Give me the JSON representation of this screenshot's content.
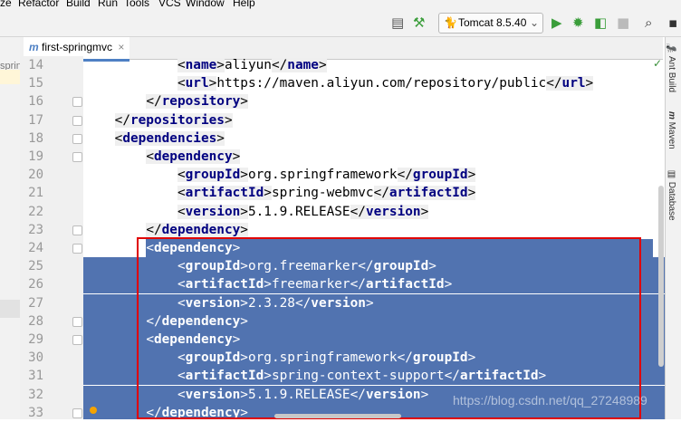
{
  "menu": [
    "ze",
    "Refactor",
    "Build",
    "Run",
    "Tools",
    "VCS",
    "Window",
    "Help"
  ],
  "toolbar": {
    "run_config": "Tomcat 8.5.40",
    "icons": [
      "build-hammer-icon",
      "run-icon",
      "debug-icon",
      "coverage-icon",
      "stop-icon",
      "search-icon"
    ]
  },
  "editor_tab": {
    "label": "first-springmvc",
    "close": "×",
    "prefix": "m"
  },
  "project_panel": {
    "text": "sprin"
  },
  "right_panel": {
    "ant_build": "Ant Build",
    "maven": "Maven",
    "database": "Database"
  },
  "lines": [
    {
      "n": "14",
      "indent": 6,
      "parts": [
        [
          "t",
          "name"
        ],
        [
          "x",
          "aliyun"
        ],
        [
          "c",
          "name"
        ]
      ],
      "sel": false
    },
    {
      "n": "15",
      "indent": 6,
      "parts": [
        [
          "t",
          "url"
        ],
        [
          "x",
          "https://maven.aliyun.com/repository/public"
        ],
        [
          "c",
          "url"
        ]
      ],
      "sel": false
    },
    {
      "n": "16",
      "indent": 4,
      "parts": [
        [
          "c",
          "repository"
        ]
      ],
      "sel": false
    },
    {
      "n": "17",
      "indent": 2,
      "parts": [
        [
          "c",
          "repositories"
        ]
      ],
      "sel": false
    },
    {
      "n": "18",
      "indent": 2,
      "parts": [
        [
          "t",
          "dependencies"
        ]
      ],
      "sel": false
    },
    {
      "n": "19",
      "indent": 4,
      "parts": [
        [
          "t",
          "dependency"
        ]
      ],
      "sel": false
    },
    {
      "n": "20",
      "indent": 6,
      "parts": [
        [
          "t",
          "groupId"
        ],
        [
          "x",
          "org.springframework"
        ],
        [
          "c",
          "groupId"
        ]
      ],
      "sel": false
    },
    {
      "n": "21",
      "indent": 6,
      "parts": [
        [
          "t",
          "artifactId"
        ],
        [
          "x",
          "spring-webmvc"
        ],
        [
          "c",
          "artifactId"
        ]
      ],
      "sel": false
    },
    {
      "n": "22",
      "indent": 6,
      "parts": [
        [
          "t",
          "version"
        ],
        [
          "x",
          "5.1.9.RELEASE"
        ],
        [
          "c",
          "version"
        ]
      ],
      "sel": false
    },
    {
      "n": "23",
      "indent": 4,
      "parts": [
        [
          "c",
          "dependency"
        ]
      ],
      "sel": false
    },
    {
      "n": "24",
      "indent": 4,
      "parts": [
        [
          "t",
          "dependency"
        ]
      ],
      "sel": true
    },
    {
      "n": "25",
      "indent": 6,
      "parts": [
        [
          "t",
          "groupId"
        ],
        [
          "x",
          "org.freemarker"
        ],
        [
          "c",
          "groupId"
        ]
      ],
      "sel": true
    },
    {
      "n": "26",
      "indent": 6,
      "parts": [
        [
          "t",
          "artifactId"
        ],
        [
          "x",
          "freemarker"
        ],
        [
          "c",
          "artifactId"
        ]
      ],
      "sel": true
    },
    {
      "n": "27",
      "indent": 6,
      "parts": [
        [
          "t",
          "version"
        ],
        [
          "x",
          "2.3.28"
        ],
        [
          "c",
          "version"
        ]
      ],
      "sel": true
    },
    {
      "n": "28",
      "indent": 4,
      "parts": [
        [
          "c",
          "dependency"
        ]
      ],
      "sel": true
    },
    {
      "n": "29",
      "indent": 4,
      "parts": [
        [
          "t",
          "dependency"
        ]
      ],
      "sel": true
    },
    {
      "n": "30",
      "indent": 6,
      "parts": [
        [
          "t",
          "groupId"
        ],
        [
          "x",
          "org.springframework"
        ],
        [
          "c",
          "groupId"
        ]
      ],
      "sel": true
    },
    {
      "n": "31",
      "indent": 6,
      "parts": [
        [
          "t",
          "artifactId"
        ],
        [
          "x",
          "spring-context-support"
        ],
        [
          "c",
          "artifactId"
        ]
      ],
      "sel": true
    },
    {
      "n": "32",
      "indent": 6,
      "parts": [
        [
          "t",
          "version"
        ],
        [
          "x",
          "5.1.9.RELEASE"
        ],
        [
          "c",
          "version"
        ]
      ],
      "sel": true
    },
    {
      "n": "33",
      "indent": 4,
      "parts": [
        [
          "c",
          "dependency"
        ]
      ],
      "sel": true
    }
  ],
  "watermark": "https://blog.csdn.net/qq_27248989",
  "colors": {
    "selection": "#5173b0",
    "tag": "#000080",
    "highlight_box": "#e00000",
    "run": "#3a9d3a"
  }
}
